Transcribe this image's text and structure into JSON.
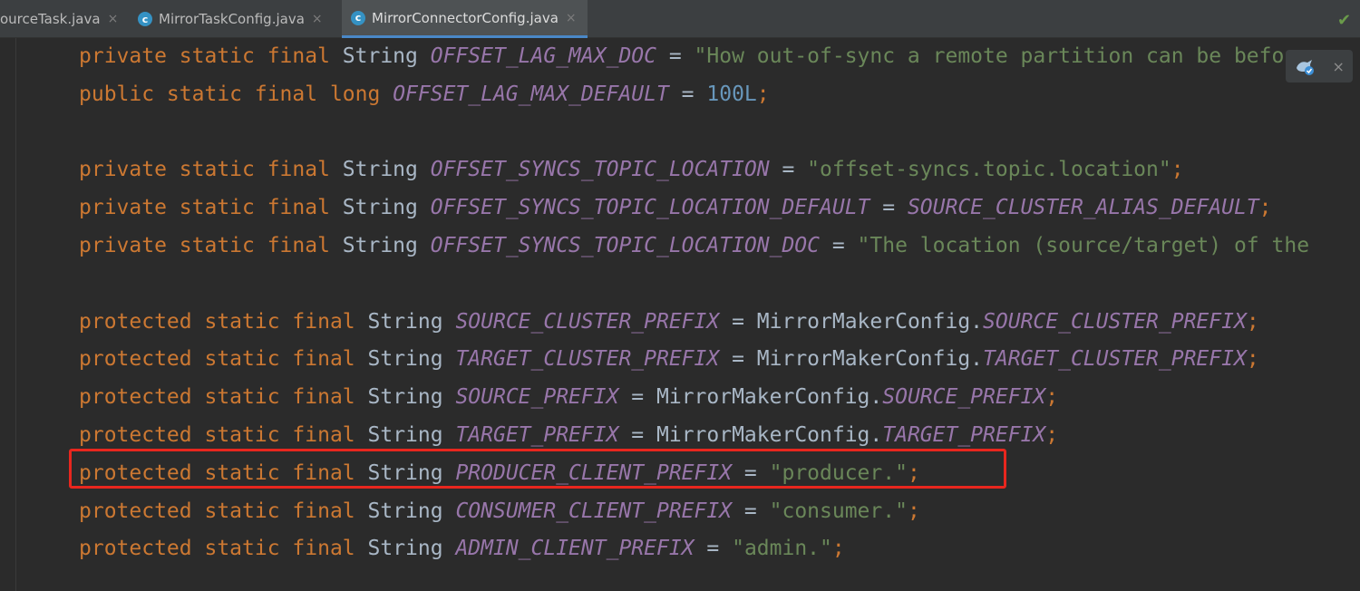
{
  "tabs": [
    {
      "label": "ourceTask.java",
      "close": "×",
      "active": false,
      "has_icon": false
    },
    {
      "label": "MirrorTaskConfig.java",
      "close": "×",
      "active": false,
      "has_icon": true,
      "icon_letter": "c"
    },
    {
      "label": "MirrorConnectorConfig.java",
      "close": "×",
      "active": true,
      "has_icon": true,
      "icon_letter": "c"
    }
  ],
  "editor": {
    "lines": [
      [
        [
          "kw",
          "private static final "
        ],
        [
          "ty",
          "String "
        ],
        [
          "cn",
          "OFFSET_LAG_MAX_DOC"
        ],
        [
          "op",
          " = "
        ],
        [
          "st",
          "\"How out-of-sync a remote partition can be befo"
        ]
      ],
      [
        [
          "kw",
          "public static final long "
        ],
        [
          "cn",
          "OFFSET_LAG_MAX_DEFAULT"
        ],
        [
          "op",
          " = "
        ],
        [
          "nm",
          "100L"
        ],
        [
          "sc",
          ";"
        ]
      ],
      [],
      [
        [
          "kw",
          "private static final "
        ],
        [
          "ty",
          "String "
        ],
        [
          "cn",
          "OFFSET_SYNCS_TOPIC_LOCATION"
        ],
        [
          "op",
          " = "
        ],
        [
          "st",
          "\"offset-syncs.topic.location\""
        ],
        [
          "sc",
          ";"
        ]
      ],
      [
        [
          "kw",
          "private static final "
        ],
        [
          "ty",
          "String "
        ],
        [
          "cn",
          "OFFSET_SYNCS_TOPIC_LOCATION_DEFAULT"
        ],
        [
          "op",
          " = "
        ],
        [
          "cn",
          "SOURCE_CLUSTER_ALIAS_DEFAULT"
        ],
        [
          "sc",
          ";"
        ]
      ],
      [
        [
          "kw",
          "private static final "
        ],
        [
          "ty",
          "String "
        ],
        [
          "cn",
          "OFFSET_SYNCS_TOPIC_LOCATION_DOC"
        ],
        [
          "op",
          " = "
        ],
        [
          "st",
          "\"The location (source/target) of the"
        ]
      ],
      [],
      [
        [
          "kw",
          "protected static final "
        ],
        [
          "ty",
          "String "
        ],
        [
          "cn",
          "SOURCE_CLUSTER_PREFIX"
        ],
        [
          "op",
          " = MirrorMakerConfig."
        ],
        [
          "cn",
          "SOURCE_CLUSTER_PREFIX"
        ],
        [
          "sc",
          ";"
        ]
      ],
      [
        [
          "kw",
          "protected static final "
        ],
        [
          "ty",
          "String "
        ],
        [
          "cn",
          "TARGET_CLUSTER_PREFIX"
        ],
        [
          "op",
          " = MirrorMakerConfig."
        ],
        [
          "cn",
          "TARGET_CLUSTER_PREFIX"
        ],
        [
          "sc",
          ";"
        ]
      ],
      [
        [
          "kw",
          "protected static final "
        ],
        [
          "ty",
          "String "
        ],
        [
          "cn",
          "SOURCE_PREFIX"
        ],
        [
          "op",
          " = MirrorMakerConfig."
        ],
        [
          "cn",
          "SOURCE_PREFIX"
        ],
        [
          "sc",
          ";"
        ]
      ],
      [
        [
          "kw",
          "protected static final "
        ],
        [
          "ty",
          "String "
        ],
        [
          "cn",
          "TARGET_PREFIX"
        ],
        [
          "op",
          " = MirrorMakerConfig."
        ],
        [
          "cn",
          "TARGET_PREFIX"
        ],
        [
          "sc",
          ";"
        ]
      ],
      [
        [
          "kw",
          "protected static final "
        ],
        [
          "ty",
          "String "
        ],
        [
          "cn",
          "PRODUCER_CLIENT_PREFIX"
        ],
        [
          "op",
          " = "
        ],
        [
          "st",
          "\"producer.\""
        ],
        [
          "sc",
          ";"
        ]
      ],
      [
        [
          "kw",
          "protected static final "
        ],
        [
          "ty",
          "String "
        ],
        [
          "cn",
          "CONSUMER_CLIENT_PREFIX"
        ],
        [
          "op",
          " = "
        ],
        [
          "st",
          "\"consumer.\""
        ],
        [
          "sc",
          ";"
        ]
      ],
      [
        [
          "kw",
          "protected static final "
        ],
        [
          "ty",
          "String "
        ],
        [
          "cn",
          "ADMIN_CLIENT_PREFIX"
        ],
        [
          "op",
          " = "
        ],
        [
          "st",
          "\"admin.\""
        ],
        [
          "sc",
          ";"
        ]
      ]
    ],
    "highlighted_line": 11
  },
  "widget": {
    "close": "×",
    "icon": "notification-bird-icon"
  },
  "inspection_icon": "checkmark-icon",
  "colors": {
    "keyword": "#cc7832",
    "constant": "#9876aa",
    "string": "#6a8759",
    "number": "#6897bb",
    "text": "#a9b7c6",
    "background": "#2b2b2b",
    "highlight": "#e8261e",
    "accent": "#4a88c7"
  }
}
